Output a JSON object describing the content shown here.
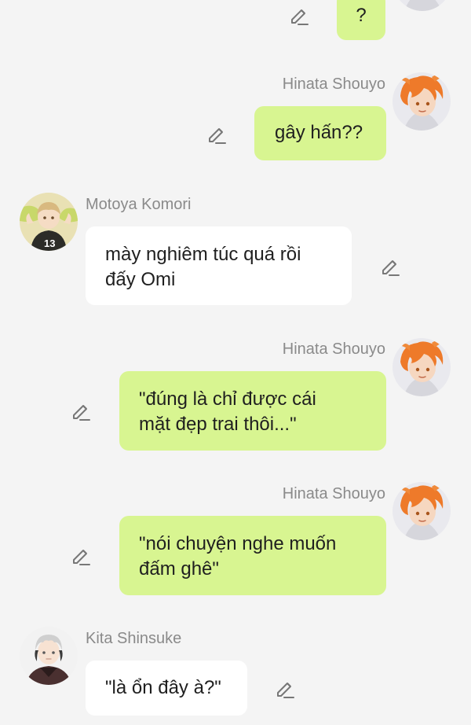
{
  "messages": [
    {
      "sender": "",
      "side": "right",
      "text": "?"
    },
    {
      "sender": "Hinata Shouyo",
      "side": "right",
      "text": "gây hấn??"
    },
    {
      "sender": "Motoya Komori",
      "side": "left",
      "text": "mày nghiêm túc quá rồi\nđấy Omi"
    },
    {
      "sender": "Hinata Shouyo",
      "side": "right",
      "text": "\"đúng là chỉ được cái\nmặt đẹp trai thôi...\""
    },
    {
      "sender": "Hinata Shouyo",
      "side": "right",
      "text": "\"nói chuyện nghe muốn\nđấm ghê\""
    },
    {
      "sender": "Kita Shinsuke",
      "side": "left",
      "text": "\"là ổn đây à?\""
    }
  ],
  "colors": {
    "background": "#f4f4f4",
    "sent_bubble": "#d8f591",
    "received_bubble": "#ffffff",
    "sender_name": "#8a8a8a",
    "message_text": "#1f1f1f",
    "edit_icon": "#777777"
  },
  "icons": {
    "edit": "pencil-edit-icon",
    "avatar_hinata": "avatar-orange-hair",
    "avatar_komori": "avatar-light-hair-jersey-13",
    "avatar_kita": "avatar-grey-hair"
  }
}
